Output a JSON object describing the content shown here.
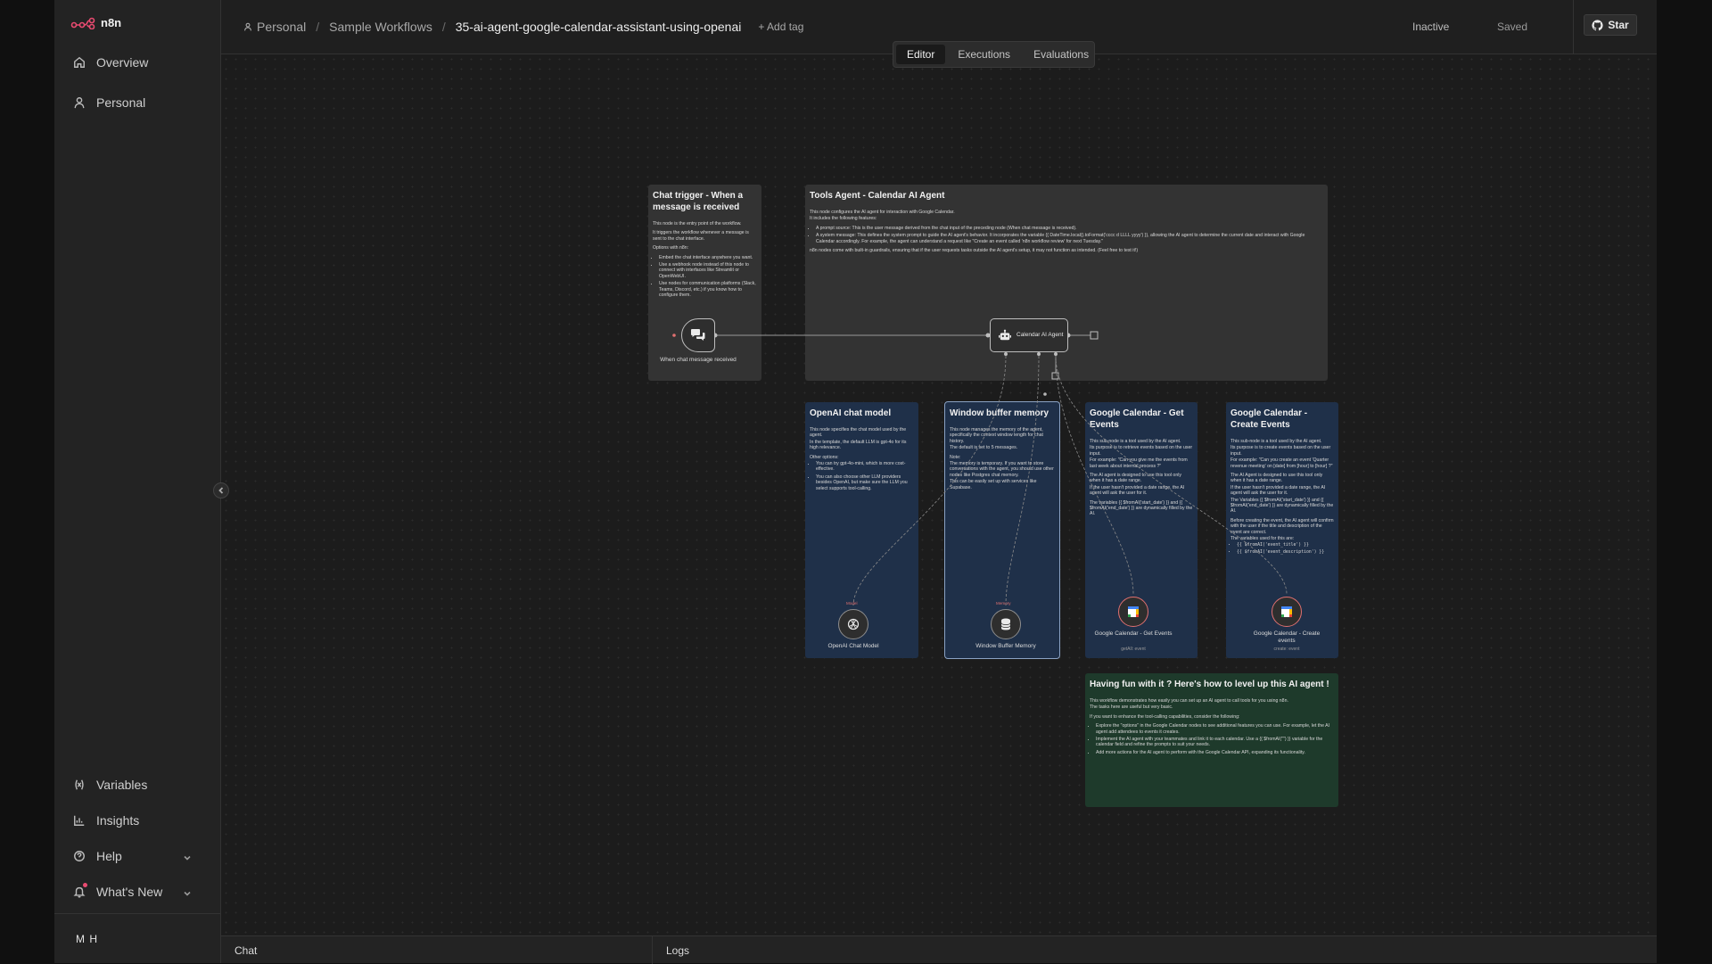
{
  "app": {
    "name": "n8n"
  },
  "sidebar": {
    "items": [
      {
        "label": "Overview",
        "icon": "home-icon"
      },
      {
        "label": "Personal",
        "icon": "user-icon"
      }
    ],
    "bottom_items": [
      {
        "label": "Variables",
        "icon": "variables-icon"
      },
      {
        "label": "Insights",
        "icon": "chart-icon"
      },
      {
        "label": "Help",
        "icon": "help-icon"
      },
      {
        "label": "What's New",
        "icon": "bell-icon"
      }
    ],
    "user_initials": "M H"
  },
  "header": {
    "breadcrumb": [
      "Personal",
      "Sample Workflows",
      "35-ai-agent-google-calendar-assistant-using-openai"
    ],
    "add_tag": "+ Add tag",
    "status": "Inactive",
    "saved": "Saved",
    "star": "Star"
  },
  "tabs": [
    "Editor",
    "Executions",
    "Evaluations"
  ],
  "notes": {
    "trigger": {
      "title": "Chat trigger - When a message is received",
      "p1": "This node is the entry point of the workflow.",
      "p2": "It triggers the workflow whenever a message is sent to the chat interface.",
      "p3": "Options with n8n:",
      "b1": "Embed the chat interface anywhere you want.",
      "b2": "Use a webhook node instead of this node to connect with interfaces like Streamlit or OpenWebUI.",
      "b3": "Use nodes for communication platforms (Slack, Teams, Discord, etc.) if you know how to configure them."
    },
    "agent": {
      "title": "Tools Agent - Calendar AI Agent",
      "p1": "This node configures the AI agent for interaction with Google Calendar.",
      "p2": "It includes the following features:",
      "b1": "A prompt source: This is the user message derived from the chat input of the preceding node (When chat message is received).",
      "b2": "A system message: This defines the system prompt to guide the AI agent's behavior. It incorporates the variable {{ DateTime.local().toFormat('cccc d LLLL yyyy') }}, allowing the AI agent to determine the current date and interact with Google Calendar accordingly. For example, the agent can understand a request like \"Create an event called 'n8n workflow review' for next Tuesday.\"",
      "p3": "n8n nodes come with built-in guardrails, ensuring that if the user requests tasks outside the AI agent's setup, it may not function as intended. (Feel free to test it!)"
    },
    "openai": {
      "title": "OpenAI chat model",
      "p1": "This node specifies the chat model used by the agent.",
      "p2": "In the template, the default LLM is gpt-4o for its high relevance.",
      "p3": "Other options:",
      "b1": "You can try gpt-4o-mini, which is more cost-effective.",
      "b2": "You can also choose other LLM providers besides OpenAI, but make sure the LLM you select supports tool-calling."
    },
    "memory": {
      "title": "Window buffer memory",
      "p1": "This node manages the memory of the agent, specifically the context window length for chat history.",
      "p2": "The default is set to 5 messages.",
      "p3": "Note:",
      "p4": "The memory is temporary. If you want to store conversations with the agent, you should use other nodes like Postgres chat memory.",
      "p5": "This can be easily set up with services like Supabase."
    },
    "get_events": {
      "title": "Google Calendar - Get Events",
      "p1": "This sub-node is a tool used by the AI agent.",
      "p2": "Its purpose is to retrieve events based on the user input.",
      "p3": "For example: \"Can you give me the events from last week about internal process ?\"",
      "p4": "The AI agent is designed to use this tool only when it has a date range.",
      "p5": "If the user hasn't provided a date range, the AI agent will ask the user for it.",
      "p6": "The variables {{ $fromAI('start_date') }} and {{ $fromAI('end_date') }} are dynamically filled by the AI."
    },
    "create_events": {
      "title": "Google Calendar - Create Events",
      "p1": "This sub-node is a tool used by the AI agent.",
      "p2": "Its purpose is to create events based on the user input.",
      "p3": "For example: \"Can you create an event 'Quarter revenue meeting' on [date] from [hour] to [hour] ?\"",
      "p4": "The AI Agent is designed to use this tool only when it has a date range.",
      "p5": "If the user hasn't provided a date range, the AI agent will ask the user for it.",
      "p6": "The Variables {{ $fromAI('start_date') }} and {{ $fromAI('end_date') }} are dynamically filled by the AI.",
      "p7": "Before creating the event, the AI agent will confirm with the user if the title and description of the event are correct.",
      "p8": "The variables used for this are:",
      "b1": "{{ $fromAI('event_title') }}",
      "b2": "{{ $fromAI('event_description') }}"
    },
    "level_up": {
      "title": "Having fun with it ? Here's how to level up this AI agent !",
      "p1": "This workflow demonstrates how easily you can set up an AI agent to call tools for you using n8n.",
      "p2": "The tasks here are useful but very basic.",
      "p3": "If you want to enhance the tool-calling capabilities, consider the following:",
      "b1": "Explore the \"options\" in the Google Calendar nodes to see additional features you can use. For example, let the AI agent add attendees to events it creates.",
      "b2": "Implement the AI agent with your teammates and link it to each calendar. Use a {{ $fromAI(\"\") }} variable for the calendar field and refine the prompts to suit your needs.",
      "b3": "Add more actions for the AI agent to perform with the Google Calendar API, expanding its functionality."
    }
  },
  "nodes": {
    "trigger": {
      "label": "When chat message received"
    },
    "agent": {
      "label": "Calendar AI Agent"
    },
    "openai": {
      "label": "OpenAI Chat Model",
      "port": "Model"
    },
    "memory": {
      "label": "Window Buffer Memory",
      "port": "Memory"
    },
    "get_events": {
      "label": "Google Calendar - Get Events",
      "sub": "getAll: event"
    },
    "create_events": {
      "label": "Google Calendar - Create events",
      "sub": "create: event"
    }
  },
  "bottom": {
    "chat": "Chat",
    "logs": "Logs"
  }
}
